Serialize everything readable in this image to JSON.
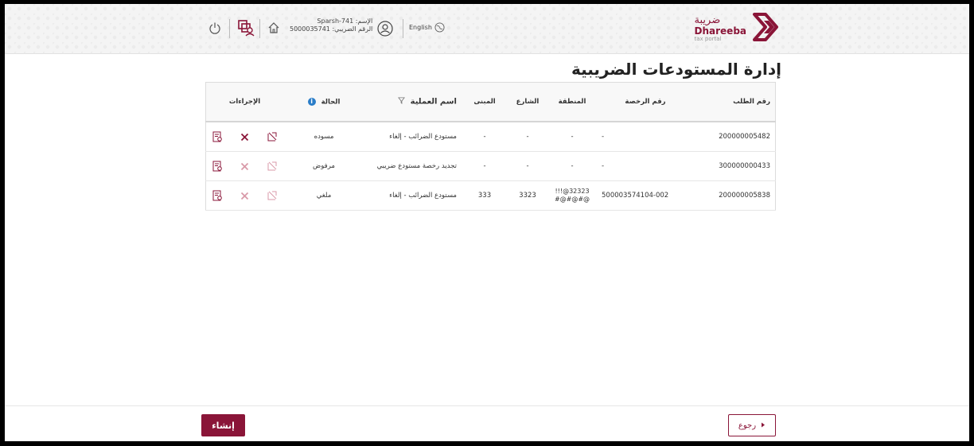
{
  "header": {
    "logo_arabic": "ضريبة",
    "logo_english": "Dhareeba",
    "logo_sub": "tax portal",
    "language_label": "English",
    "user_name": "الإسم: Sparsh-741",
    "tax_number": "الرقم الضريبي: 5000035741"
  },
  "page_title": "إدارة المستودعات الضريبية",
  "table": {
    "headers": {
      "request_no": "رقم الطلب",
      "license_no": "رقم الرخصة",
      "area": "المنطقة",
      "street": "الشارع",
      "building": "المبنى",
      "operation": "اسم العملية",
      "status": "الحالة",
      "actions": "الإجراءات"
    },
    "rows": [
      {
        "request_no": "200000005482",
        "license_no": "-",
        "area": "-",
        "street": "-",
        "building": "-",
        "operation": "مستودع الضرائب - إلغاء",
        "status": "مسوده",
        "actions_enabled": true
      },
      {
        "request_no": "300000000433",
        "license_no": "-",
        "area": "-",
        "street": "-",
        "building": "-",
        "operation": "تجديد رخصة مستودع ضريبي",
        "status": "مرفوض",
        "actions_enabled": false
      },
      {
        "request_no": "200000005838",
        "license_no": "500003574104-002",
        "area": "32323@!!!@#@#@#",
        "street": "3323",
        "building": "333",
        "operation": "مستودع الضرائب - إلغاء",
        "status": "ملغي",
        "actions_enabled": false
      }
    ]
  },
  "footer": {
    "create_label": "إنشاء",
    "back_label": "رجوع"
  },
  "colors": {
    "brand": "#8a1538",
    "info": "#2a7dc8"
  },
  "icons": [
    "logo-icon",
    "globe-icon",
    "user-icon",
    "home-icon",
    "switch-profile-icon",
    "power-icon",
    "filter-icon",
    "info-icon",
    "view-document-icon",
    "delete-icon",
    "edit-icon",
    "arrow-icon"
  ]
}
